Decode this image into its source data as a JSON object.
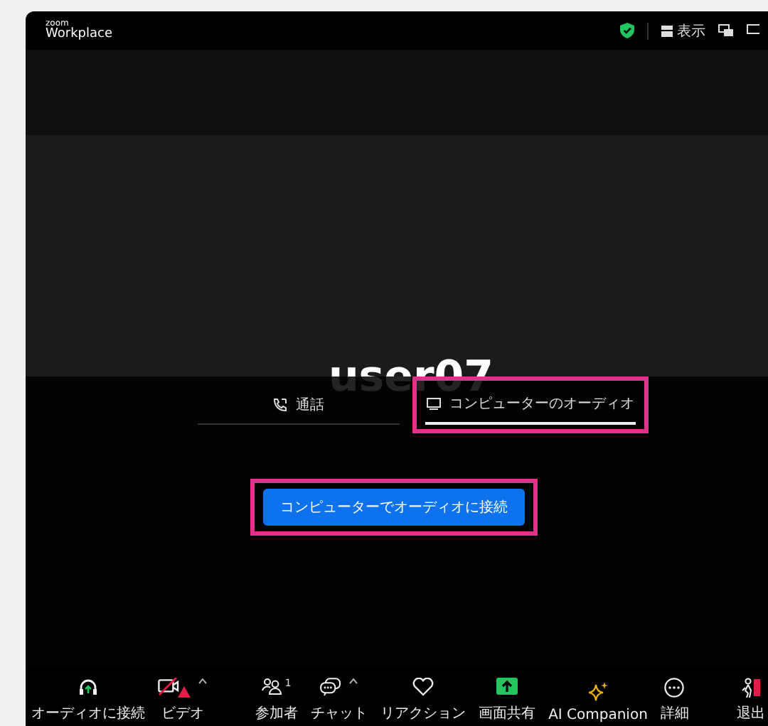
{
  "app": {
    "logo_small": "zoom",
    "logo": "Workplace"
  },
  "top_bar": {
    "view_label": "表示"
  },
  "participant_name": "user07",
  "audio_tabs": [
    {
      "label": "通話",
      "selected": false,
      "highlighted": false
    },
    {
      "label": "コンピューターのオーディオ",
      "selected": true,
      "highlighted": true
    }
  ],
  "connect_button": {
    "label": "コンピューターでオーディオに接続",
    "highlighted": true
  },
  "toolbar": [
    {
      "label": "オーディオに接続"
    },
    {
      "label": "ビデオ",
      "caret": true,
      "warning": true
    },
    {
      "label": "参加者",
      "count": "1"
    },
    {
      "label": "チャット",
      "caret": true
    },
    {
      "label": "リアクション"
    },
    {
      "label": "画面共有"
    },
    {
      "label": "AI Companion"
    },
    {
      "label": "詳細"
    },
    {
      "label": "退出"
    }
  ]
}
